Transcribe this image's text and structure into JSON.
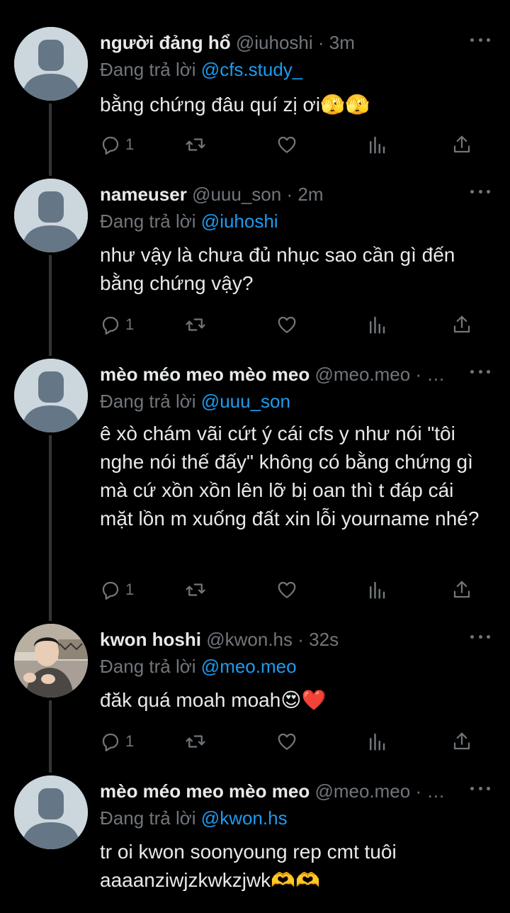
{
  "reply_prefix": "Đang trả lời",
  "tweets": [
    {
      "name": "người đảng hổ",
      "handle": "@iuhoshi",
      "dot": "·",
      "time": "3m",
      "reply_to": "@cfs.study_",
      "text": "bằng chứng đâu quí zị ơi🫣🫣",
      "reply_count": "1",
      "avatar": "default"
    },
    {
      "name": "nameuser",
      "handle": "@uuu_son",
      "dot": "·",
      "time": "2m",
      "reply_to": "@iuhoshi",
      "text": "như vậy là chưa đủ nhục sao cần gì đến bằng chứng vậy?",
      "reply_count": "1",
      "avatar": "default"
    },
    {
      "name": "mèo méo meo mèo meo",
      "handle": "@meo.meo",
      "dot": "·",
      "time": "…",
      "reply_to": "@uuu_son",
      "text": "ê xò chám vãi cứt ý cái cfs y như nói \"tôi nghe nói thế đấy\" không có bằng chứng gì mà cứ xồn xồn lên lỡ bị oan thì t đáp cái mặt lồn m xuống đất xin lỗi yourname nhé?",
      "reply_count": "1",
      "avatar": "default"
    },
    {
      "name": "kwon hoshi",
      "handle": "@kwon.hs",
      "dot": "·",
      "time": "32s",
      "reply_to": "@meo.meo",
      "text": "đăk quá moah moah😍❤️",
      "reply_count": "1",
      "avatar": "photo"
    },
    {
      "name": "mèo méo meo mèo meo",
      "handle": "@meo.meo",
      "dot": "·",
      "time": "…",
      "reply_to": "@kwon.hs",
      "text": "tr oi kwon soonyoung rep cmt tuôi aaaanziwjzkwkzjwk🫶🫶",
      "reply_count": "",
      "avatar": "default"
    }
  ],
  "icons": {
    "reply": "reply-icon",
    "retweet": "retweet-icon",
    "like": "heart-icon",
    "views": "views-icon",
    "share": "share-icon",
    "more": "more-icon"
  },
  "colors": {
    "background": "#000000",
    "text": "#e7e9ea",
    "muted": "#71767b",
    "accent": "#1d9bf0",
    "thread_line": "#333639",
    "avatar_bg": "#ccd6dd",
    "avatar_fg": "#657786"
  }
}
